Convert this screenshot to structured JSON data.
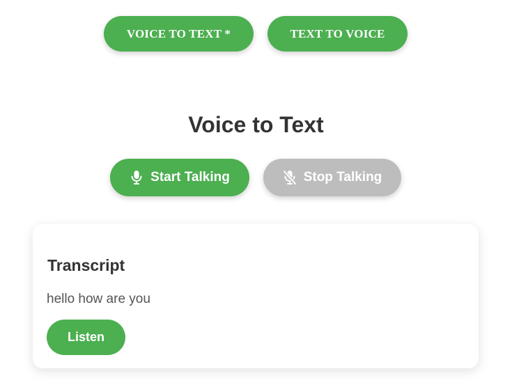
{
  "mode_tabs": {
    "voice_to_text_label": "VOICE TO TEXT *",
    "text_to_voice_label": "TEXT TO VOICE"
  },
  "section": {
    "title": "Voice to Text"
  },
  "controls": {
    "start_label": "Start Talking",
    "start_icon": "microphone-icon",
    "stop_label": "Stop Talking",
    "stop_icon": "microphone-off-icon"
  },
  "transcript": {
    "title": "Transcript",
    "text": "hello how are you",
    "listen_label": "Listen"
  },
  "colors": {
    "accent": "#4caf50",
    "disabled": "#bdbdbd",
    "text": "#333333"
  }
}
